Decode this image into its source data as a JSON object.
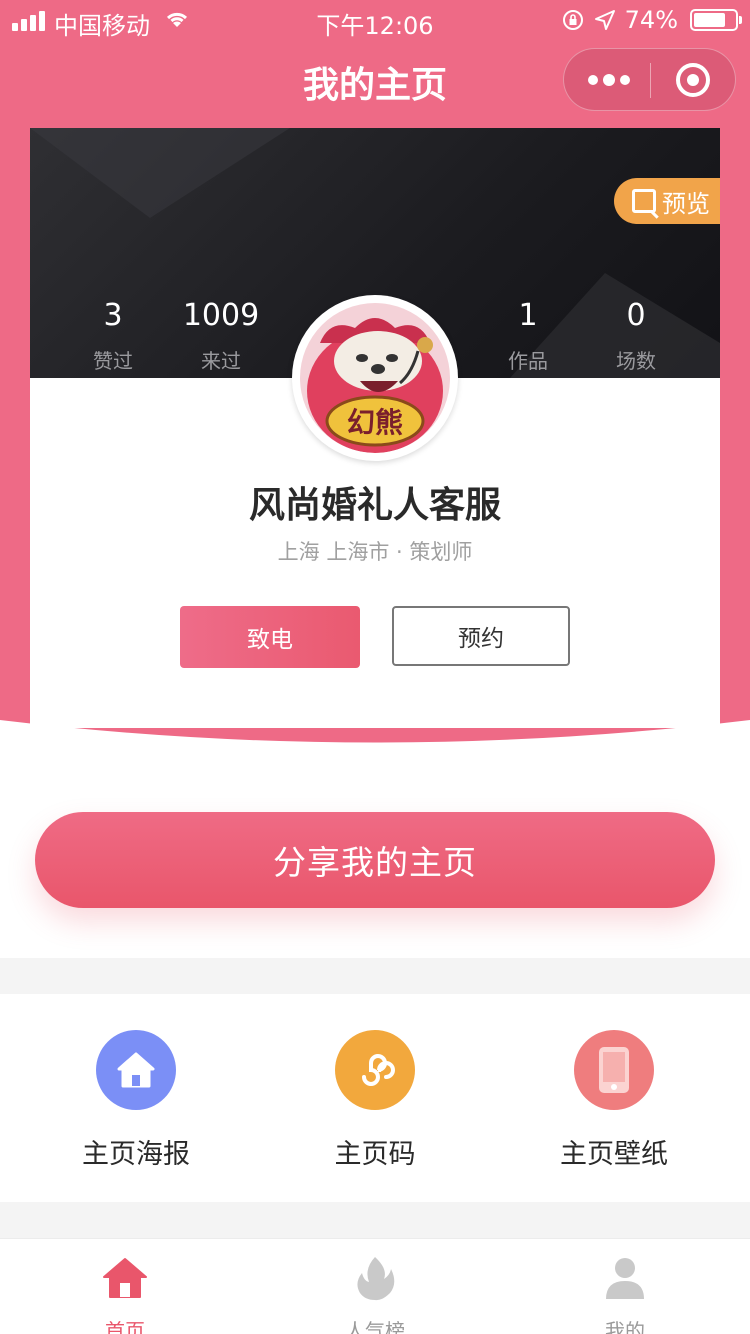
{
  "status_bar": {
    "carrier": "中国移动",
    "time": "下午12:06",
    "battery": "74%"
  },
  "nav": {
    "title": "我的主页"
  },
  "profile": {
    "preview_label": "预览",
    "stats": [
      {
        "value": "3",
        "label": "赞过"
      },
      {
        "value": "1009",
        "label": "来过"
      },
      {
        "value": "1",
        "label": "作品"
      },
      {
        "value": "0",
        "label": "场数"
      }
    ],
    "avatar_text": "幻熊",
    "name": "风尚婚礼人客服",
    "location": "上海 上海市 · 策划师",
    "call_label": "致电",
    "book_label": "预约"
  },
  "share": {
    "label": "分享我的主页"
  },
  "tools": [
    {
      "label": "主页海报",
      "icon": "home-icon",
      "color": "#7b8ff6"
    },
    {
      "label": "主页码",
      "icon": "miniprogram-icon",
      "color": "#f2a83d"
    },
    {
      "label": "主页壁纸",
      "icon": "phone-icon",
      "color": "#ef7d7e"
    }
  ],
  "tabbar": {
    "tabs": [
      {
        "label": "首页",
        "icon": "home-icon",
        "active": true
      },
      {
        "label": "人气榜",
        "icon": "flame-icon",
        "active": false
      },
      {
        "label": "我的",
        "icon": "user-icon",
        "active": false
      }
    ]
  },
  "colors": {
    "brand_pink": "#ee6a86",
    "accent_orange": "#f1a44a",
    "active_tab": "#e9566b"
  }
}
